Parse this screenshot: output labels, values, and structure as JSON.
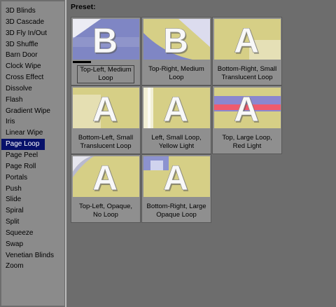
{
  "transitions": [
    "3D Blinds",
    "3D Cascade",
    "3D Fly In/Out",
    "3D Shuffle",
    "Barn Door",
    "Clock Wipe",
    "Cross Effect",
    "Dissolve",
    "Flash",
    "Gradient Wipe",
    "Iris",
    "Linear Wipe",
    "Page Loop",
    "Page Peel",
    "Page Roll",
    "Portals",
    "Push",
    "Slide",
    "Spiral",
    "Split",
    "Squeeze",
    "Swap",
    "Venetian Blinds",
    "Zoom"
  ],
  "selected_transition": "Page Loop",
  "preset_label": "Preset:",
  "presets": [
    {
      "line1": "Top-Left, Medium",
      "line2": "Loop",
      "selected": true,
      "thumb_letter": "B"
    },
    {
      "line1": "Top-Right, Medium",
      "line2": "Loop",
      "selected": false,
      "thumb_letter": "B"
    },
    {
      "line1": "Bottom-Right, Small",
      "line2": "Translucent Loop",
      "selected": false,
      "thumb_letter": "A"
    },
    {
      "line1": "Bottom-Left, Small",
      "line2": "Translucent Loop",
      "selected": false,
      "thumb_letter": "A"
    },
    {
      "line1": "Left, Small Loop,",
      "line2": "Yellow Light",
      "selected": false,
      "thumb_letter": "A"
    },
    {
      "line1": "Top, Large Loop,",
      "line2": "Red Light",
      "selected": false,
      "thumb_letter": "A"
    },
    {
      "line1": "Top-Left, Opaque,",
      "line2": "No Loop",
      "selected": false,
      "thumb_letter": "A"
    },
    {
      "line1": "Bottom-Right, Large",
      "line2": "Opaque Loop",
      "selected": false,
      "thumb_letter": "A"
    }
  ],
  "colors": {
    "selection_bg": "#07116a",
    "thumb_yellow": "#d6cf86",
    "thumb_blue": "#7f86c4"
  }
}
